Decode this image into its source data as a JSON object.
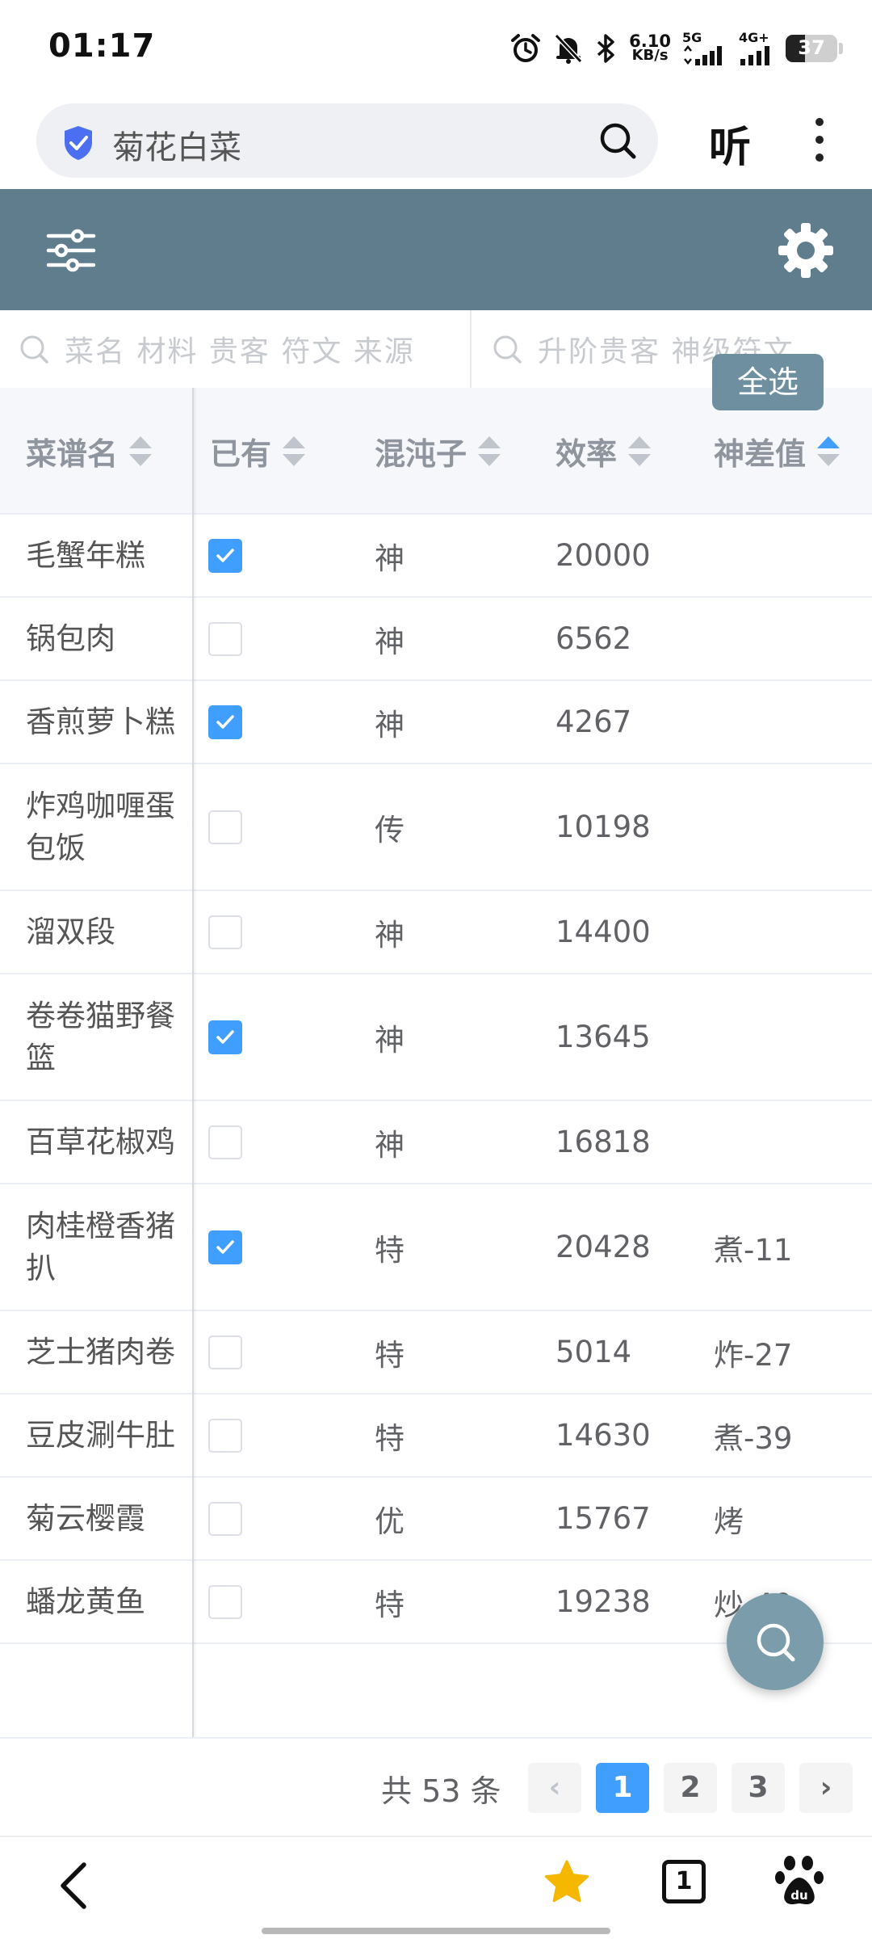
{
  "status_bar": {
    "time": "01:17",
    "net_speed_value": "6.10",
    "net_speed_unit": "KB/s",
    "network_5g": "5G",
    "network_4g": "4G+",
    "battery": "37",
    "battery_level": 0.37
  },
  "browser": {
    "search_text": "菊花白菜",
    "listen_label": "听"
  },
  "filters": {
    "left_placeholder": "菜名 材料 贵客 符文 来源",
    "right_placeholder": "升阶贵客 神级符文",
    "select_all_label": "全选"
  },
  "table": {
    "columns": [
      {
        "label": "菜谱名",
        "sort": "none"
      },
      {
        "label": "已有",
        "sort": "none"
      },
      {
        "label": "混沌子",
        "sort": "none"
      },
      {
        "label": "效率",
        "sort": "none"
      },
      {
        "label": "神差值",
        "sort": "asc"
      }
    ],
    "rows": [
      {
        "name": "毛蟹年糕",
        "owned": true,
        "mix": "神",
        "eff": "20000",
        "diff": ""
      },
      {
        "name": "锅包肉",
        "owned": false,
        "mix": "神",
        "eff": "6562",
        "diff": ""
      },
      {
        "name": "香煎萝卜糕",
        "owned": true,
        "mix": "神",
        "eff": "4267",
        "diff": ""
      },
      {
        "name": "炸鸡咖喱蛋包饭",
        "owned": false,
        "mix": "传",
        "eff": "10198",
        "diff": ""
      },
      {
        "name": "溜双段",
        "owned": false,
        "mix": "神",
        "eff": "14400",
        "diff": ""
      },
      {
        "name": "卷卷猫野餐篮",
        "owned": true,
        "mix": "神",
        "eff": "13645",
        "diff": ""
      },
      {
        "name": "百草花椒鸡",
        "owned": false,
        "mix": "神",
        "eff": "16818",
        "diff": ""
      },
      {
        "name": "肉桂橙香猪扒",
        "owned": true,
        "mix": "特",
        "eff": "20428",
        "diff": "煮-11"
      },
      {
        "name": "芝士猪肉卷",
        "owned": false,
        "mix": "特",
        "eff": "5014",
        "diff": "炸-27"
      },
      {
        "name": "豆皮涮牛肚",
        "owned": false,
        "mix": "特",
        "eff": "14630",
        "diff": "煮-39"
      },
      {
        "name": "菊云樱霞",
        "owned": false,
        "mix": "优",
        "eff": "15767",
        "diff": "烤"
      },
      {
        "name": "蟠龙黄鱼",
        "owned": false,
        "mix": "特",
        "eff": "19238",
        "diff": "炒-40"
      }
    ]
  },
  "pagination": {
    "total_label": "共 53 条",
    "pages": [
      "1",
      "2",
      "3"
    ],
    "current": "1",
    "prev_label": "‹",
    "next_label": "›"
  },
  "bottom_nav": {
    "tabs_count": "1"
  },
  "colors": {
    "header_bg": "#5f7d8c",
    "accent": "#409eff",
    "fab_bg": "#7a9cab",
    "star": "#f5b700"
  }
}
